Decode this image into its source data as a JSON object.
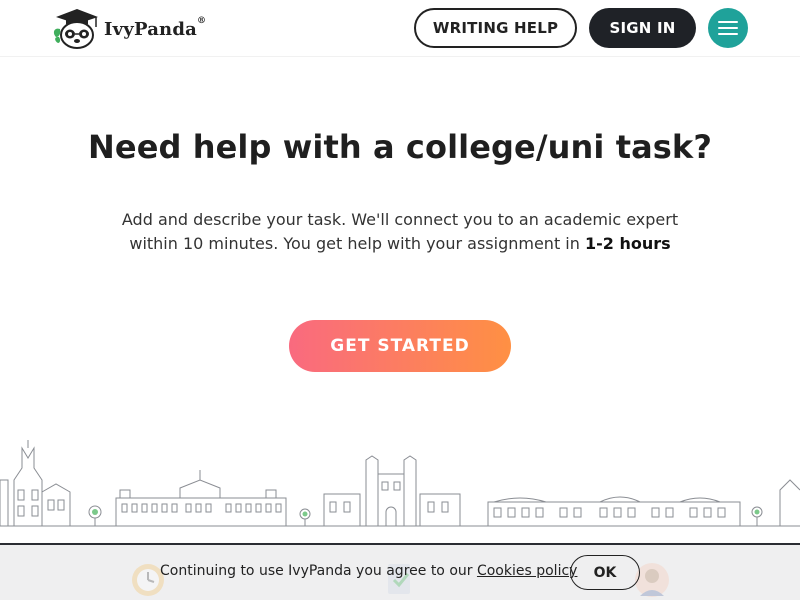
{
  "header": {
    "logo_text": "IvyPanda",
    "logo_reg": "®",
    "writing_help_label": "WRITING HELP",
    "sign_in_label": "SIGN IN",
    "menu_icon": "hamburger-menu-icon",
    "menu_bg": "#1fa29a"
  },
  "hero": {
    "title": "Need help with a college/uni task?",
    "description": "Add and describe your task. We'll connect you to an academic expert within 10 minutes. You get help with your assignment in ",
    "description_bold": "1-2 hours",
    "cta_label": "GET STARTED",
    "cta_gradient": [
      "#f96a7f",
      "#ff9043"
    ]
  },
  "cookie": {
    "text": "Continuing to use IvyPanda you agree to our ",
    "link_label": "Cookies policy",
    "ok_label": "OK"
  },
  "icons": [
    "panda-logo-icon",
    "clock-icon",
    "document-check-icon",
    "expert-avatar-icon",
    "skyline-illustration"
  ]
}
